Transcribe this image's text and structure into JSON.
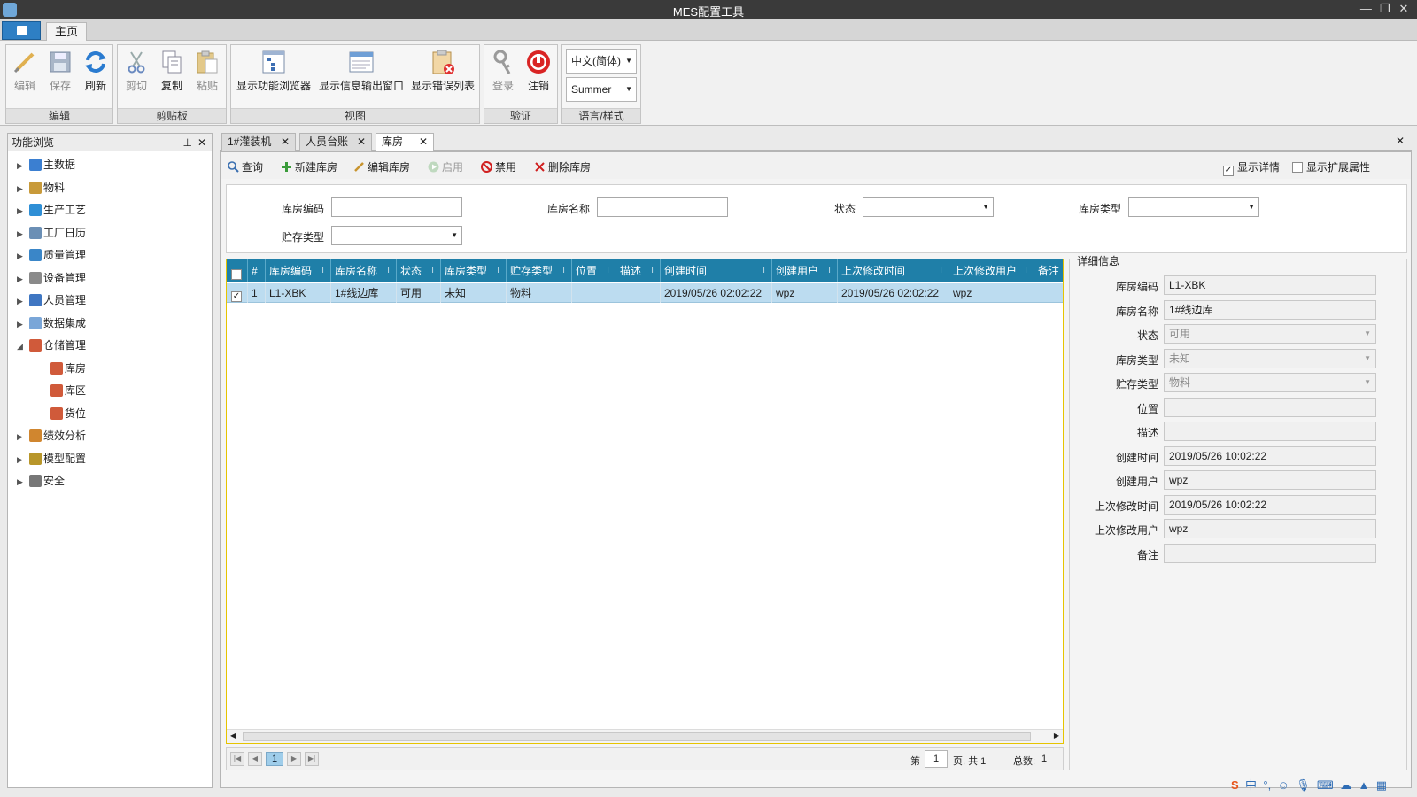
{
  "window": {
    "title": "MES配置工具",
    "controls": [
      "—",
      "❐",
      "✕"
    ]
  },
  "ribbon": {
    "tab_home": "主页",
    "groups": {
      "edit": {
        "name": "编辑",
        "buttons": [
          "编辑",
          "保存",
          "刷新"
        ]
      },
      "clipboard": {
        "name": "剪贴板",
        "buttons": [
          "剪切",
          "复制",
          "粘贴"
        ]
      },
      "view": {
        "name": "视图",
        "buttons": [
          "显示功能浏览器",
          "显示信息输出窗口",
          "显示错误列表"
        ]
      },
      "auth": {
        "name": "验证",
        "buttons": [
          "登录",
          "注销"
        ]
      },
      "lang": {
        "name": "语言/样式",
        "language": "中文(简体)",
        "style": "Summer"
      }
    }
  },
  "left_panel": {
    "title": "功能浏览",
    "items": [
      {
        "label": "主数据",
        "level": 0,
        "expanded": false
      },
      {
        "label": "物料",
        "level": 0,
        "expanded": false
      },
      {
        "label": "生产工艺",
        "level": 0,
        "expanded": false
      },
      {
        "label": "工厂日历",
        "level": 0,
        "expanded": false
      },
      {
        "label": "质量管理",
        "level": 0,
        "expanded": false
      },
      {
        "label": "设备管理",
        "level": 0,
        "expanded": false
      },
      {
        "label": "人员管理",
        "level": 0,
        "expanded": false
      },
      {
        "label": "数据集成",
        "level": 0,
        "expanded": false
      },
      {
        "label": "仓储管理",
        "level": 0,
        "expanded": true
      },
      {
        "label": "库房",
        "level": 1
      },
      {
        "label": "库区",
        "level": 1
      },
      {
        "label": "货位",
        "level": 1
      },
      {
        "label": "绩效分析",
        "level": 0,
        "expanded": false
      },
      {
        "label": "模型配置",
        "level": 0,
        "expanded": false
      },
      {
        "label": "安全",
        "level": 0,
        "expanded": false
      }
    ]
  },
  "doc_tabs": [
    "1#灌装机",
    "人员台账",
    "库房"
  ],
  "toolbar": {
    "query": "查询",
    "new": "新建库房",
    "edit": "编辑库房",
    "enable": "启用",
    "disable": "禁用",
    "delete": "删除库房",
    "show_detail": "显示详情",
    "show_ext": "显示扩展属性"
  },
  "search": {
    "code_label": "库房编码",
    "name_label": "库房名称",
    "status_label": "状态",
    "type_label": "库房类型",
    "storage_label": "贮存类型"
  },
  "grid": {
    "columns": [
      "#",
      "库房编码",
      "库房名称",
      "状态",
      "库房类型",
      "贮存类型",
      "位置",
      "描述",
      "创建时间",
      "创建用户",
      "上次修改时间",
      "上次修改用户",
      "备注"
    ],
    "rows": [
      [
        "1",
        "L1-XBK",
        "1#线边库",
        "可用",
        "未知",
        "物料",
        "",
        "",
        "2019/05/26 02:02:22",
        "wpz",
        "2019/05/26 02:02:22",
        "wpz",
        ""
      ]
    ]
  },
  "pager": {
    "current": "1",
    "page_prefix": "第",
    "page_input": "1",
    "page_suffix": "页, 共 1",
    "total_label": "总数:",
    "total": "1"
  },
  "detail": {
    "title": "详细信息",
    "fields": [
      {
        "label": "库房编码",
        "value": "L1-XBK"
      },
      {
        "label": "库房名称",
        "value": "1#线边库"
      },
      {
        "label": "状态",
        "value": "可用"
      },
      {
        "label": "库房类型",
        "value": "未知"
      },
      {
        "label": "贮存类型",
        "value": "物料"
      },
      {
        "label": "位置",
        "value": ""
      },
      {
        "label": "描述",
        "value": ""
      },
      {
        "label": "创建时间",
        "value": "2019/05/26 10:02:22"
      },
      {
        "label": "创建用户",
        "value": "wpz"
      },
      {
        "label": "上次修改时间",
        "value": "2019/05/26 10:02:22"
      },
      {
        "label": "上次修改用户",
        "value": "wpz"
      },
      {
        "label": "备注",
        "value": ""
      }
    ]
  },
  "ime": {
    "logo": "S",
    "lang": "中"
  },
  "colors": {
    "grid_header": "#1f7fa8",
    "selected_row": "#bcdcf0",
    "accent": "#2e7fc4"
  }
}
